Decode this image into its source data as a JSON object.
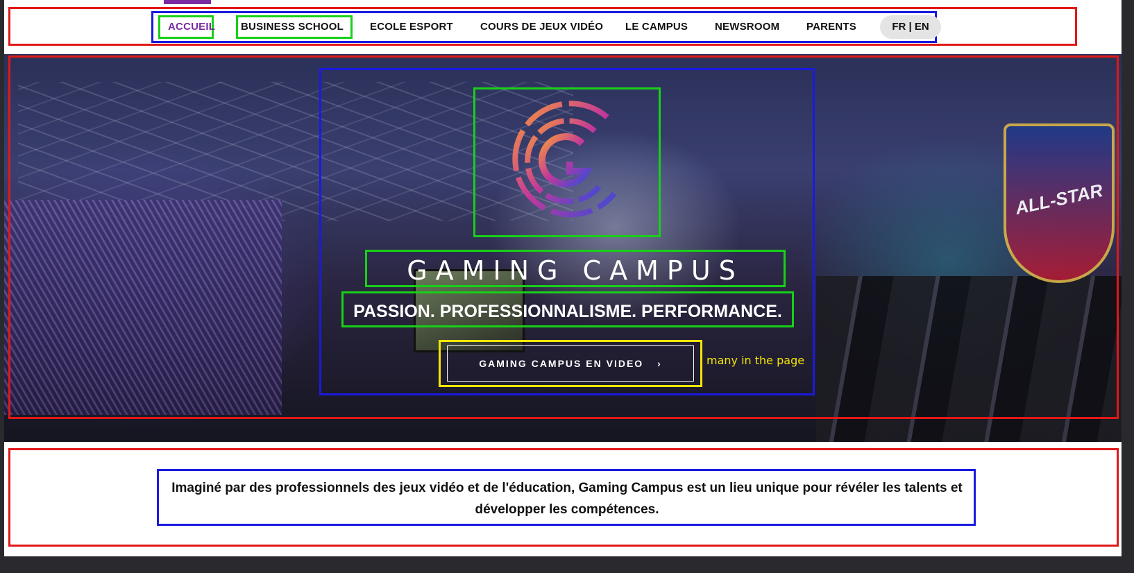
{
  "nav": {
    "items": [
      {
        "label": "ACCUEIL"
      },
      {
        "label": "BUSINESS SCHOOL"
      },
      {
        "label": "ECOLE ESPORT"
      },
      {
        "label": "COURS DE JEUX VIDÉO"
      },
      {
        "label": "LE CAMPUS"
      },
      {
        "label": "NEWSROOM"
      },
      {
        "label": "PARENTS"
      }
    ],
    "language": "FR | EN"
  },
  "hero": {
    "logo_icon": "gaming-campus-logo-icon",
    "brand": "GAMING CAMPUS",
    "tagline": "PASSION. PROFESSIONNALISME. PERFORMANCE.",
    "cta_label": "GAMING CAMPUS EN VIDEO",
    "cta_icon": "chevron-right-icon",
    "cta_chevron": "›",
    "note": "many in the page",
    "banner_text": "ALL-STAR"
  },
  "intro": {
    "text": "Imaginé par des professionnels des jeux vidéo et de l'éducation, Gaming Campus est un lieu unique pour révéler les talents et développer les compétences."
  },
  "colors": {
    "accent": "#7a2aa0",
    "annotation_red": "#e11818",
    "annotation_blue": "#1a1ae0",
    "annotation_green": "#18d018",
    "annotation_yellow": "#f5e600"
  }
}
